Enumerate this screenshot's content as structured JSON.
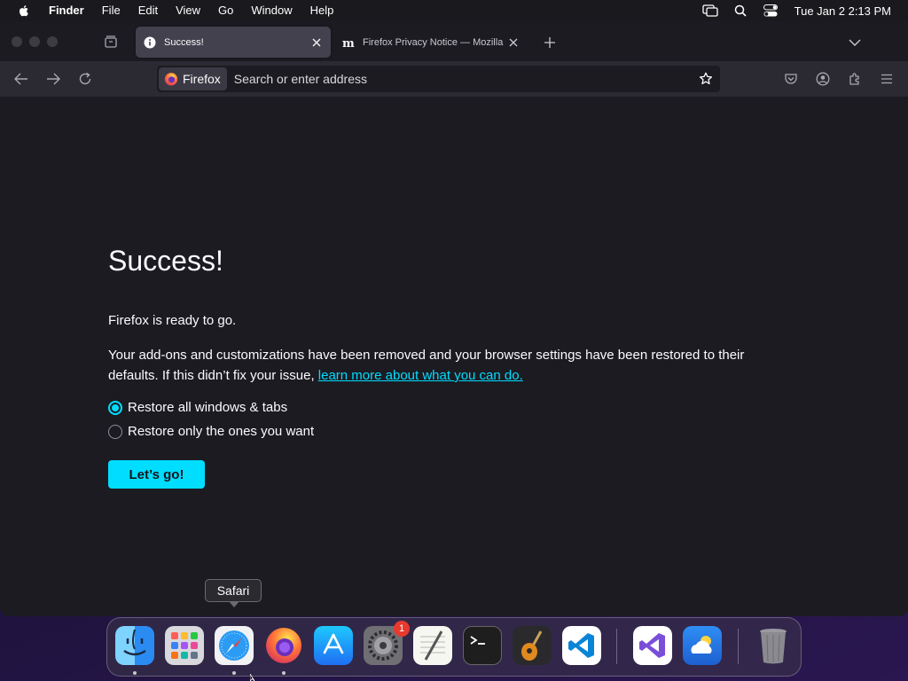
{
  "menubar": {
    "items": [
      "Finder",
      "File",
      "Edit",
      "View",
      "Go",
      "Window",
      "Help"
    ],
    "clock": "Tue Jan 2  2:13 PM",
    "status_icons": [
      "screen-mirroring-icon",
      "spotlight-search-icon",
      "control-center-icon"
    ]
  },
  "tabs": [
    {
      "title": "Success!",
      "icon": "info-icon",
      "active": true
    },
    {
      "title": "Firefox Privacy Notice — Mozilla",
      "icon": "mozilla-m-icon",
      "active": false
    }
  ],
  "urlbar": {
    "identity_label": "Firefox",
    "placeholder": "Search or enter address"
  },
  "page": {
    "title": "Success!",
    "ready_text": "Firefox is ready to go.",
    "body_text": "Your add-ons and customizations have been removed and your browser settings have been restored to their defaults. If this didn’t fix your issue, ",
    "link_text": "learn more about what you can do.",
    "options": [
      {
        "label": "Restore all windows & tabs",
        "checked": true
      },
      {
        "label": "Restore only the ones you want",
        "checked": false
      }
    ],
    "button_label": "Let’s go!"
  },
  "dock": {
    "tooltip": "Safari",
    "apps": [
      "Finder",
      "Launchpad",
      "Safari",
      "Firefox",
      "App Store",
      "System Settings",
      "TextEdit",
      "Terminal",
      "GarageBand",
      "Visual Studio Code",
      "Visual Studio",
      "Weather",
      "Trash"
    ],
    "settings_badge": "1"
  },
  "colors": {
    "accent": "#00ddff",
    "window_bg": "#1c1b22",
    "toolbar_bg": "#2b2a33",
    "active_tab_bg": "#42414d"
  }
}
